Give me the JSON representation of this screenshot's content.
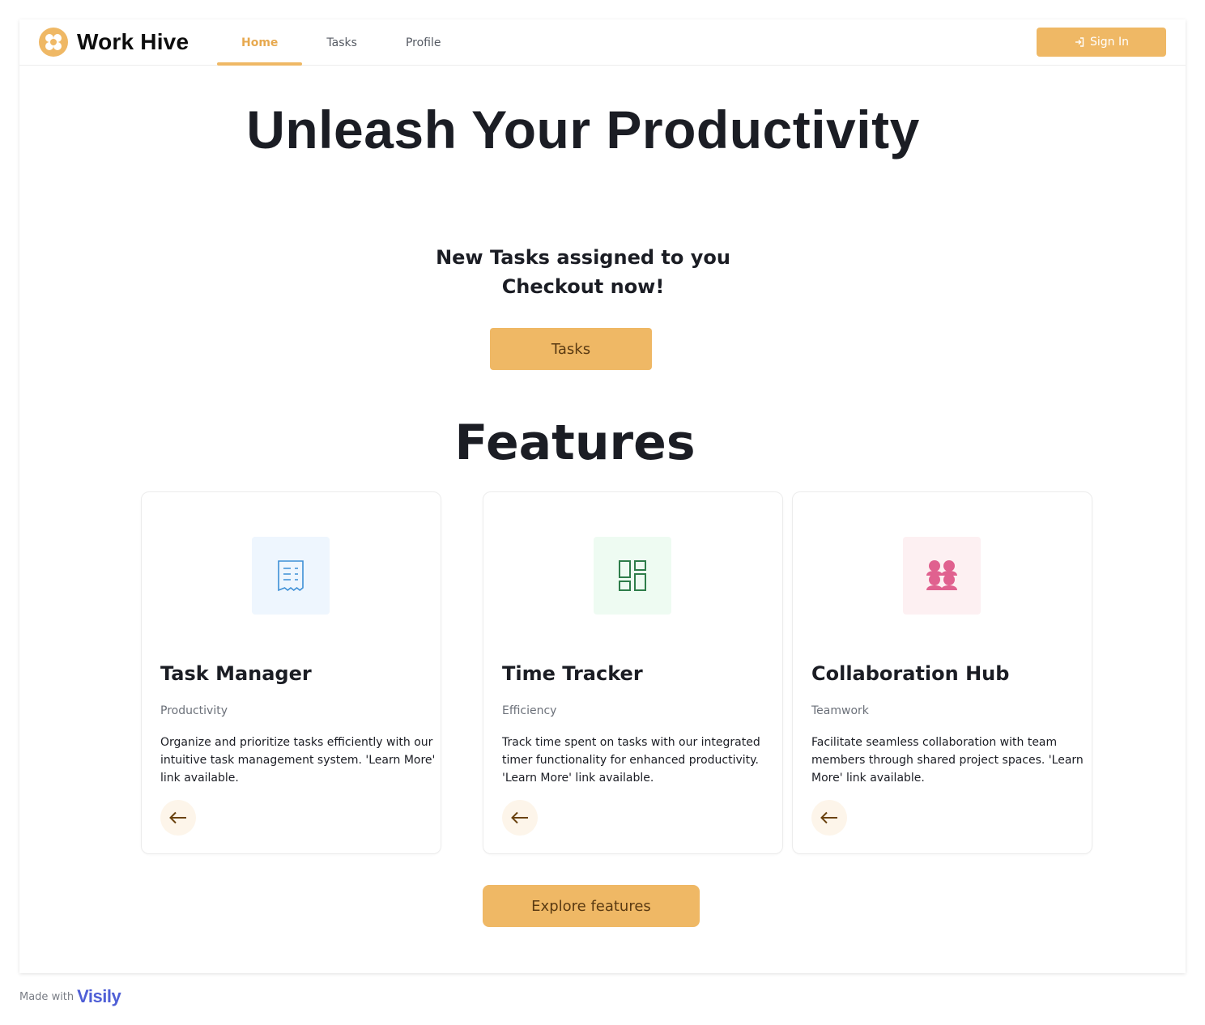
{
  "app": {
    "name": "Work Hive",
    "brand_color": "#efb865"
  },
  "nav": {
    "tabs": [
      {
        "label": "Home",
        "active": true
      },
      {
        "label": "Tasks",
        "active": false
      },
      {
        "label": "Profile",
        "active": false
      }
    ]
  },
  "header": {
    "signin_label": "Sign In",
    "signin_icon": "sign-in-icon"
  },
  "hero": {
    "title": "Unleash Your Productivity"
  },
  "promo": {
    "line1": "New Tasks assigned to you",
    "line2": "Checkout now!",
    "button_label": "Tasks"
  },
  "features": {
    "title": "Features",
    "cards": [
      {
        "title": "Task Manager",
        "category": "Productivity",
        "description": "Organize and prioritize tasks efficiently with our intuitive task management system. 'Learn More' link available.",
        "icon": "receipt-icon",
        "icon_color": "#3d8fd6",
        "icon_bg": "#eef6fe"
      },
      {
        "title": "Time Tracker",
        "category": "Efficiency",
        "description": "Track time spent on tasks with our integrated timer functionality for enhanced productivity. 'Learn More' link available.",
        "icon": "dashboard-icon",
        "icon_color": "#2e7d4a",
        "icon_bg": "#eefbf2"
      },
      {
        "title": "Collaboration Hub",
        "category": "Teamwork",
        "description": "Facilitate seamless collaboration with team members through shared project spaces. 'Learn More' link available.",
        "icon": "team-icon",
        "icon_color": "#e0618f",
        "icon_bg": "#fdf0f2"
      }
    ],
    "explore_label": "Explore features"
  },
  "footer": {
    "made_with": "Made with",
    "brand": "Visily"
  }
}
